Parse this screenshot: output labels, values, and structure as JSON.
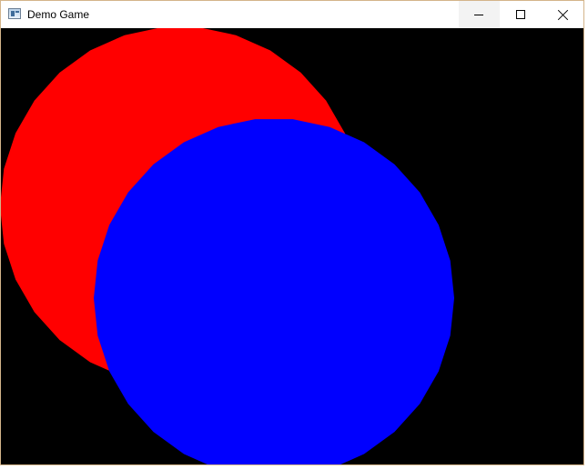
{
  "window": {
    "title": "Demo Game",
    "icon": "application-window-icon"
  },
  "caption_buttons": {
    "minimize_icon": "minimize-icon",
    "maximize_icon": "maximize-icon",
    "close_icon": "close-icon"
  },
  "scene": {
    "background_color": "#000000",
    "shapes": [
      {
        "name": "red-circle",
        "color": "#ff0000"
      },
      {
        "name": "blue-circle",
        "color": "#0000ff"
      }
    ]
  }
}
